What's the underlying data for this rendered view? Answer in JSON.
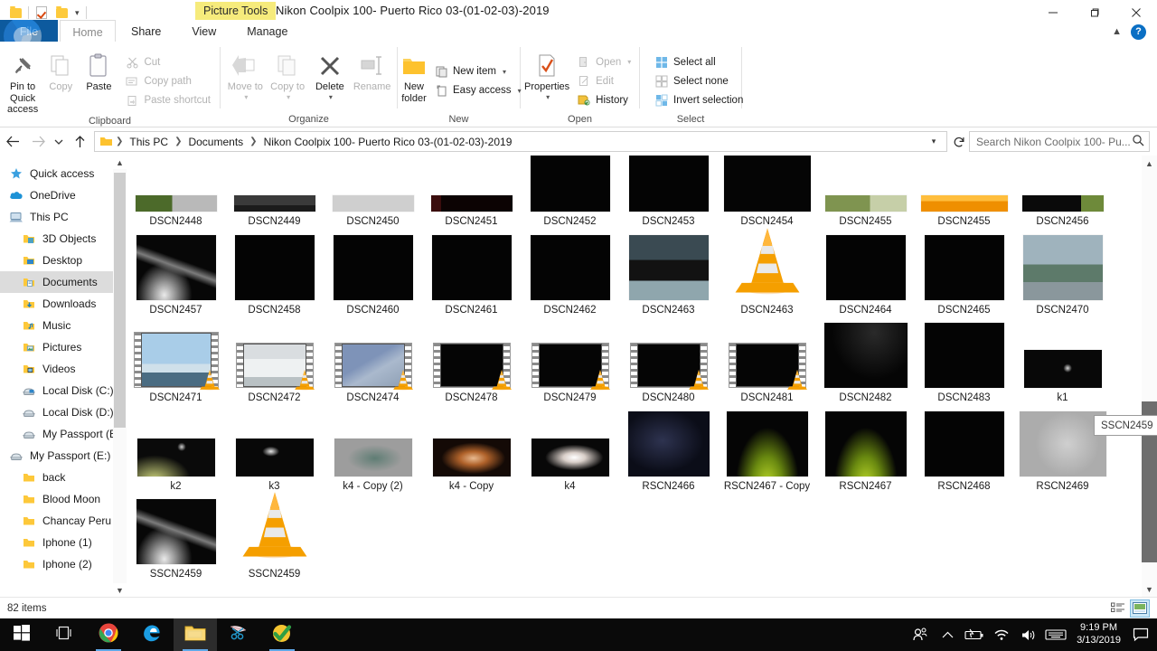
{
  "window": {
    "picture_tools_label": "Picture Tools",
    "title": "Nikon Coolpix 100- Puerto Rico 03-(01-02-03)-2019",
    "minimize": "─",
    "maximize": "❐",
    "close": "✕"
  },
  "tabs": {
    "file": "File",
    "home": "Home",
    "share": "Share",
    "view": "View",
    "manage": "Manage",
    "collapse_icon": "chevron-up-icon",
    "help": "?"
  },
  "ribbon": {
    "groups": [
      {
        "label": "Clipboard",
        "big": [
          {
            "label": "Pin to Quick access",
            "icon": "pin-icon",
            "disabled": false
          },
          {
            "label": "Copy",
            "icon": "copy-icon",
            "disabled": true
          },
          {
            "label": "Paste",
            "icon": "paste-icon",
            "disabled": false
          }
        ],
        "small": [
          {
            "label": "Cut",
            "icon": "scissors-icon",
            "disabled": true
          },
          {
            "label": "Copy path",
            "icon": "copy-path-icon",
            "disabled": true
          },
          {
            "label": "Paste shortcut",
            "icon": "paste-shortcut-icon",
            "disabled": true
          }
        ]
      },
      {
        "label": "Organize",
        "big": [
          {
            "label": "Move to",
            "icon": "move-to-icon",
            "disabled": true,
            "caret": true
          },
          {
            "label": "Copy to",
            "icon": "copy-to-icon",
            "disabled": true,
            "caret": true
          },
          {
            "label": "Delete",
            "icon": "delete-x-icon",
            "disabled": false,
            "caret": true
          },
          {
            "label": "Rename",
            "icon": "rename-icon",
            "disabled": true
          }
        ],
        "small": []
      },
      {
        "label": "New",
        "big": [
          {
            "label": "New folder",
            "icon": "new-folder-icon",
            "disabled": false
          }
        ],
        "small": [
          {
            "label": "New item",
            "icon": "new-item-icon",
            "disabled": false,
            "caret": true
          },
          {
            "label": "Easy access",
            "icon": "easy-access-icon",
            "disabled": false,
            "caret": true
          }
        ]
      },
      {
        "label": "Open",
        "big": [
          {
            "label": "Properties",
            "icon": "properties-icon",
            "disabled": false,
            "caret": true
          }
        ],
        "small": [
          {
            "label": "Open",
            "icon": "open-icon",
            "disabled": true,
            "caret": true
          },
          {
            "label": "Edit",
            "icon": "edit-icon",
            "disabled": true
          },
          {
            "label": "History",
            "icon": "history-icon",
            "disabled": false
          }
        ]
      },
      {
        "label": "Select",
        "big": [],
        "small": [
          {
            "label": "Select all",
            "icon": "select-all-icon",
            "disabled": false
          },
          {
            "label": "Select none",
            "icon": "select-none-icon",
            "disabled": false
          },
          {
            "label": "Invert selection",
            "icon": "invert-selection-icon",
            "disabled": false
          }
        ]
      }
    ]
  },
  "addressbar": {
    "back_icon": "arrow-left-icon",
    "forward_icon": "arrow-right-icon",
    "recent_icon": "chevron-down-icon",
    "up_icon": "arrow-up-icon",
    "crumbs": [
      "This PC",
      "Documents",
      "Nikon Coolpix 100- Puerto Rico 03-(01-02-03)-2019"
    ],
    "refresh_icon": "refresh-icon",
    "search_placeholder": "Search Nikon Coolpix 100- Pu...",
    "search_value": "",
    "search_icon": "search-icon"
  },
  "navpane": {
    "items": [
      {
        "label": "Quick access",
        "icon": "star-icon",
        "indent": 0,
        "selected": false
      },
      {
        "label": "OneDrive",
        "icon": "cloud-icon",
        "indent": 0,
        "selected": false
      },
      {
        "label": "This PC",
        "icon": "pc-icon",
        "indent": 0,
        "selected": false
      },
      {
        "label": "3D Objects",
        "icon": "folder-3d-icon",
        "indent": 1,
        "selected": false
      },
      {
        "label": "Desktop",
        "icon": "folder-desktop-icon",
        "indent": 1,
        "selected": false
      },
      {
        "label": "Documents",
        "icon": "folder-documents-icon",
        "indent": 1,
        "selected": true
      },
      {
        "label": "Downloads",
        "icon": "folder-downloads-icon",
        "indent": 1,
        "selected": false
      },
      {
        "label": "Music",
        "icon": "folder-music-icon",
        "indent": 1,
        "selected": false
      },
      {
        "label": "Pictures",
        "icon": "folder-pictures-icon",
        "indent": 1,
        "selected": false
      },
      {
        "label": "Videos",
        "icon": "folder-videos-icon",
        "indent": 1,
        "selected": false
      },
      {
        "label": "Local Disk (C:)",
        "icon": "drive-system-icon",
        "indent": 1,
        "selected": false
      },
      {
        "label": "Local Disk (D:)",
        "icon": "drive-icon",
        "indent": 1,
        "selected": false
      },
      {
        "label": "My Passport (E:)",
        "icon": "drive-icon",
        "indent": 1,
        "selected": false
      },
      {
        "label": "My Passport (E:)",
        "icon": "drive-icon",
        "indent": 0,
        "selected": false
      },
      {
        "label": "back",
        "icon": "folder-icon",
        "indent": 1,
        "selected": false
      },
      {
        "label": "Blood Moon",
        "icon": "folder-icon",
        "indent": 1,
        "selected": false
      },
      {
        "label": "Chancay Peru - D",
        "icon": "folder-icon",
        "indent": 1,
        "selected": false
      },
      {
        "label": "Iphone (1)",
        "icon": "folder-icon",
        "indent": 1,
        "selected": false
      },
      {
        "label": "Iphone (2)",
        "icon": "folder-icon",
        "indent": 1,
        "selected": false
      }
    ]
  },
  "files": [
    {
      "name": "DSCN2448",
      "kind": "photo",
      "style": "greenband",
      "clipped": true
    },
    {
      "name": "DSCN2449",
      "kind": "photo",
      "style": "grayband",
      "clipped": true
    },
    {
      "name": "DSCN2450",
      "kind": "photo",
      "style": "lightgray",
      "clipped": true
    },
    {
      "name": "DSCN2451",
      "kind": "photo",
      "style": "darkred",
      "clipped": true
    },
    {
      "name": "DSCN2452",
      "kind": "photo",
      "style": "black",
      "clipped": true
    },
    {
      "name": "DSCN2453",
      "kind": "photo",
      "style": "black",
      "clipped": true
    },
    {
      "name": "DSCN2454",
      "kind": "photo",
      "style": "blackwide",
      "clipped": true
    },
    {
      "name": "DSCN2455",
      "kind": "photo",
      "style": "greenblur",
      "clipped": true
    },
    {
      "name": "DSCN2455",
      "kind": "photo",
      "style": "orange",
      "clipped": true
    },
    {
      "name": "DSCN2456",
      "kind": "photo",
      "style": "blackgreen",
      "clipped": true
    },
    {
      "name": "DSCN2457",
      "kind": "photo",
      "style": "smokeplume"
    },
    {
      "name": "DSCN2458",
      "kind": "photo",
      "style": "black"
    },
    {
      "name": "DSCN2460",
      "kind": "photo",
      "style": "black"
    },
    {
      "name": "DSCN2461",
      "kind": "photo",
      "style": "black"
    },
    {
      "name": "DSCN2462",
      "kind": "photo",
      "style": "black"
    },
    {
      "name": "DSCN2463",
      "kind": "photo",
      "style": "table"
    },
    {
      "name": "DSCN2463",
      "kind": "video-vlc",
      "style": "vlccone"
    },
    {
      "name": "DSCN2464",
      "kind": "photo",
      "style": "black"
    },
    {
      "name": "DSCN2465",
      "kind": "photo",
      "style": "black"
    },
    {
      "name": "DSCN2470",
      "kind": "photo",
      "style": "street"
    },
    {
      "name": "DSCN2471",
      "kind": "video",
      "style": "seascape"
    },
    {
      "name": "DSCN2472",
      "kind": "video",
      "style": "whitehaze"
    },
    {
      "name": "DSCN2474",
      "kind": "video",
      "style": "bluehaze"
    },
    {
      "name": "DSCN2478",
      "kind": "video",
      "style": "blackfilm"
    },
    {
      "name": "DSCN2479",
      "kind": "video",
      "style": "blackfilm"
    },
    {
      "name": "DSCN2480",
      "kind": "video",
      "style": "blackfilm"
    },
    {
      "name": "DSCN2481",
      "kind": "video",
      "style": "blackfilm"
    },
    {
      "name": "DSCN2482",
      "kind": "photo",
      "style": "blackglow"
    },
    {
      "name": "DSCN2483",
      "kind": "photo",
      "style": "black"
    },
    {
      "name": "k1",
      "kind": "photo",
      "style": "k1"
    },
    {
      "name": "k2",
      "kind": "photo",
      "style": "k2"
    },
    {
      "name": "k3",
      "kind": "photo",
      "style": "k3"
    },
    {
      "name": "k4 - Copy (2)",
      "kind": "photo",
      "style": "k4blur"
    },
    {
      "name": "k4 - Copy",
      "kind": "photo",
      "style": "k4warm"
    },
    {
      "name": "k4",
      "kind": "photo",
      "style": "k4white"
    },
    {
      "name": "RSCN2466",
      "kind": "photo",
      "style": "navyglow"
    },
    {
      "name": "RSCN2467 - Copy",
      "kind": "photo",
      "style": "greenbottom"
    },
    {
      "name": "RSCN2467",
      "kind": "photo",
      "style": "greenbottom"
    },
    {
      "name": "RSCN2468",
      "kind": "photo",
      "style": "black"
    },
    {
      "name": "RSCN2469",
      "kind": "photo",
      "style": "gray"
    },
    {
      "name": "SSCN2459",
      "kind": "photo",
      "style": "smokeplume"
    },
    {
      "name": "SSCN2459",
      "kind": "video-vlc",
      "style": "vlccone"
    }
  ],
  "tooltip": {
    "text": "SSCN2459"
  },
  "statusbar": {
    "count": "82 items",
    "details_view_icon": "details-view-icon",
    "large_icons_view_icon": "large-icons-view-icon"
  },
  "taskbar": {
    "items": [
      {
        "name": "start-button",
        "icon": "windows-logo-icon",
        "running": false
      },
      {
        "name": "task-view-button",
        "icon": "task-view-icon",
        "running": false
      },
      {
        "name": "chrome-button",
        "icon": "chrome-icon",
        "running": true
      },
      {
        "name": "edge-button",
        "icon": "edge-icon",
        "running": false
      },
      {
        "name": "file-explorer-button",
        "icon": "folder-icon",
        "running": true,
        "active": true
      },
      {
        "name": "snipping-tool-button",
        "icon": "snip-icon",
        "running": false
      },
      {
        "name": "checkmark-app-button",
        "icon": "check-circle-icon",
        "running": true
      }
    ],
    "tray": [
      {
        "name": "people-icon"
      },
      {
        "name": "show-hidden-icons-icon"
      },
      {
        "name": "battery-icon"
      },
      {
        "name": "wifi-icon"
      },
      {
        "name": "volume-icon"
      },
      {
        "name": "keyboard-icon"
      }
    ],
    "clock": {
      "time": "9:19 PM",
      "date": "3/13/2019"
    },
    "notification_icon": "notification-center-icon"
  }
}
